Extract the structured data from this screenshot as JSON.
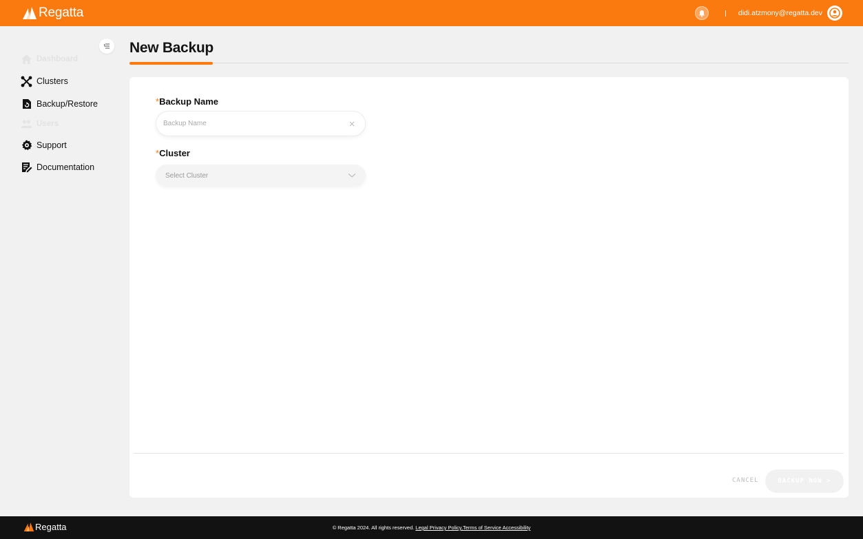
{
  "header": {
    "logo_text": "Regatta",
    "user_email": "didi.atzmony@regatta.dev",
    "brand_color": "#fa7a10"
  },
  "sidebar": {
    "items": [
      {
        "label": "Dashboard",
        "icon": "home-icon",
        "enabled": false
      },
      {
        "label": "Clusters",
        "icon": "clusters-icon",
        "enabled": true
      },
      {
        "label": "Backup/Restore",
        "icon": "backup-icon",
        "enabled": true
      },
      {
        "label": "Users",
        "icon": "users-icon",
        "enabled": false
      },
      {
        "label": "Support",
        "icon": "gear-icon",
        "enabled": true
      },
      {
        "label": "Documentation",
        "icon": "document-edit-icon",
        "enabled": true
      }
    ]
  },
  "page": {
    "title": "New Backup"
  },
  "form": {
    "backup_name": {
      "required_mark": "*",
      "label": "Backup Name",
      "placeholder": "Backup Name",
      "value": ""
    },
    "cluster": {
      "required_mark": "*",
      "label": "Cluster",
      "placeholder": "Select Cluster"
    },
    "cancel_label": "CANCEL",
    "submit_label": "BACKUP NOW >"
  },
  "footer": {
    "logo_text": "Regatta",
    "copyright": "© Regatta 2024. All rights reserved.",
    "links": [
      "Legal Privacy Policy",
      ",Terms of Service Accessibility"
    ]
  }
}
